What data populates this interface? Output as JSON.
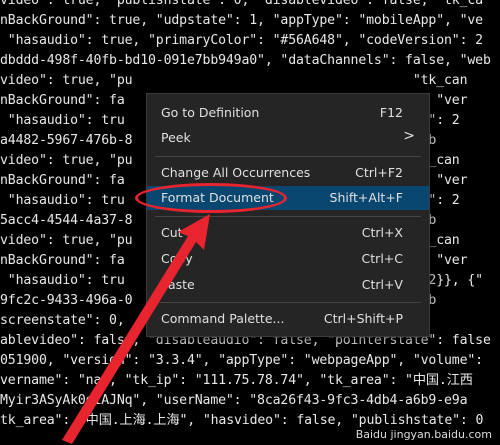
{
  "code_lines": [
    "video\": true, \"publishstate\": 0, \"disablevideo\": false, \"tk_ca",
    "nBackGround\": true, \"udpstate\": 1, \"appType\": \"mobileApp\", \"ve",
    " \"hasaudio\": true, \"primaryColor\": \"#56A648\", \"codeVersion\": 2",
    "dbddd-498f-40fb-bd10-091e7bb949a0\", \"dataChannels\": false, \"web",
    "video\": true, \"pu                                    \"tk_can",
    "nBackGround\": fa                                  App\", \"ver",
    " \"hasaudio\": tru                                   sion\": 2",
    "a4482-5967-476b-8                                   \"web",
    "video\": true, \"pu                                   \"tk_can",
    "nBackGround\": fa                                  App\", \"ver",
    " \"hasaudio\": tru                                   sion\": 2",
    "5acc4-4544-4a37-8                                   \"web",
    "video\": true, \"pu                                   \"tk_can",
    "nBackGround\": fa                                  App\", \"ver",
    " \"hasaudio\": tru                                   e\": 2}}, {\"",
    "9fc2c-9433-496a-0                                   \"web",
    "screenstate\": 0,                             lstream\"",
    "ablevideo\": false, \"disableaudio\": false, \"pointerstate\": false",
    "051900, \"version\": \"3.3.4\", \"appType\": \"webpageApp\", \"volume\":",
    "vername\": \"na\", \"tk_ip\": \"111.75.78.74\", \"tk_area\": \"中国.江西",
    "Myir3ASyAk0diAJNq\", \"userName\": \"8ca26f43-9fc3-4db4-a6b9-e9a",
    "tk_area\": \"中国.上海.上海\", \"hasvideo\": false, \"publishstate\": 0"
  ],
  "context_menu": {
    "items": [
      {
        "label": "Go to Definition",
        "shortcut": "F12"
      },
      {
        "label": "Peek",
        "shortcut": ""
      },
      {
        "label": "Change All Occurrences",
        "shortcut": "Ctrl+F2"
      },
      {
        "label": "Format Document",
        "shortcut": "Shift+Alt+F"
      },
      {
        "label": "Cut",
        "shortcut": "Ctrl+X"
      },
      {
        "label": "Copy",
        "shortcut": "Ctrl+C"
      },
      {
        "label": "Paste",
        "shortcut": "Ctrl+V"
      },
      {
        "label": "Command Palette...",
        "shortcut": "Ctrl+Shift+P"
      }
    ],
    "peek_chevron": ">",
    "selected_index": 3
  },
  "annotation_colors": {
    "highlight": "#e8242e",
    "menu_bg": "#252526",
    "selection": "#094771"
  },
  "watermark": "Baidu jingyan.baidu.com"
}
